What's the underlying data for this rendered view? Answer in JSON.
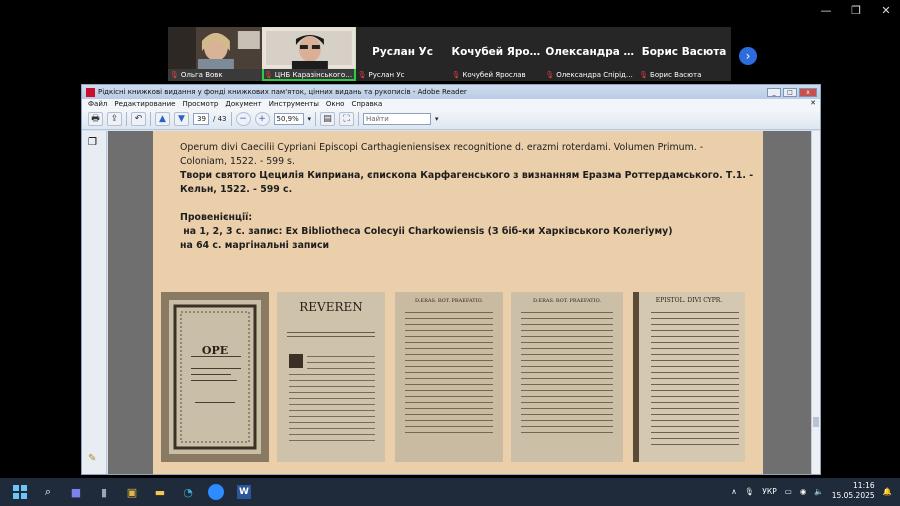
{
  "window_controls": {
    "minimize": "—",
    "maximize": "❐",
    "close": "✕"
  },
  "zoom_strip": {
    "participants": [
      {
        "name": "Ольга Вовк",
        "video": true,
        "active": false
      },
      {
        "name": "ЦНБ Каразінського уні...",
        "video": true,
        "active": true
      },
      {
        "name": "Руслан Ус",
        "display": "Руслан Ус",
        "video": false,
        "active": false
      },
      {
        "name": "Кочубей Ярослав",
        "display": "Кочубей Ярослав",
        "video": false,
        "active": false
      },
      {
        "name": "Олександра Спірідон...",
        "display": "Олександра Сп...",
        "video": false,
        "active": false
      },
      {
        "name": "Борис Васюта",
        "display": "Борис Васюта",
        "video": false,
        "active": false
      }
    ],
    "next_icon": "›"
  },
  "acrobat": {
    "title": "Рідкісні книжкові видання у фонді книжкових пам'яток, цінних видань та рукописів - Adobe Reader",
    "menu": [
      "Файл",
      "Редактирование",
      "Просмотр",
      "Документ",
      "Инструменты",
      "Окно",
      "Справка"
    ],
    "close_doc": "✕",
    "toolbar": {
      "page_current": "39",
      "page_total": "/ 43",
      "zoom": "50,9%",
      "search_placeholder": "Найти"
    },
    "page": {
      "lines": [
        {
          "text": "Operum divi Caecilii Cypriani Episcopi Carthagieniensisex recognitione d. erazmi roterdami. Volumen Primum. -",
          "bold": false
        },
        {
          "text": "Coloniam, 1522. - 599 s.",
          "bold": false
        },
        {
          "text": "Твори святого Цецилія Киприана, єпископа Карфагенського з визнанням Еразма Роттердамського. Т.1.  -",
          "bold": true
        },
        {
          "text": "Кельн, 1522. - 599 с.",
          "bold": true
        },
        {
          "text": "",
          "bold": false
        },
        {
          "text": "Провенієнції:",
          "bold": true
        },
        {
          "text": " на 1, 2, 3 с. запис: Ex Bibliotheca Colecyii Charkowiensis (З біб-ки Харківського Колегіуму)",
          "bold": true
        },
        {
          "text": "на 64 с. маргінальні записи",
          "bold": true
        }
      ],
      "photo_captions": [
        "OPE",
        "REVEREN",
        "D.ERAS. ROT. PRAEFATIO.",
        "D.ERAS. ROT. PRAEFATIO.",
        "EPISTOL. DIVI CYPR."
      ]
    }
  },
  "taskbar": {
    "icons": [
      "windows-start",
      "search",
      "meet",
      "notes",
      "store",
      "files",
      "edge",
      "zoom",
      "word"
    ],
    "language": "УКР",
    "time": "11:16",
    "date": "15.05.2025"
  }
}
